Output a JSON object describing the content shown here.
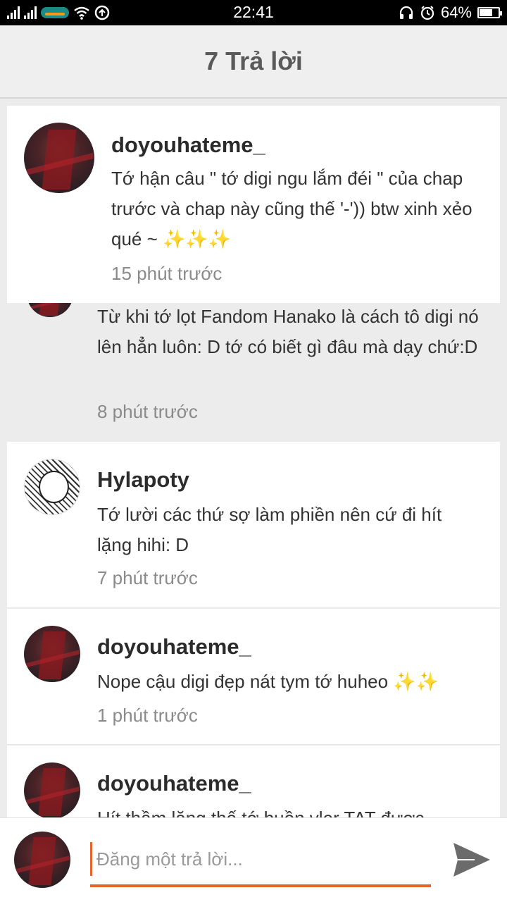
{
  "status_bar": {
    "time": "22:41",
    "battery_percent": "64%",
    "battery_level": 0.64,
    "icons": [
      "signal-icon",
      "signal-icon",
      "carrier-logo",
      "wifi-icon",
      "sync-icon",
      "headset-icon",
      "alarm-icon",
      "battery-icon"
    ]
  },
  "header": {
    "title": "7 Trả lời"
  },
  "comments": [
    {
      "username": "doyouhateme_",
      "text": "Tớ hận câu \" tớ digi ngu lắm đéi \" của chap trước và chap này cũng thế '-')) btw xinh xẻo qué ~ ✨✨✨",
      "time": "15 phút trước"
    },
    {
      "username": "",
      "text": "Từ khi tớ lọt Fandom Hanako là cách tô digi nó lên hẳn luôn: D tớ có biết gì đâu mà dạy chứ:D",
      "time": "8 phút trước"
    },
    {
      "username": "Hylapoty",
      "text": "Tớ lười các thứ sợ làm phiền nên cứ đi hít lặng hihi: D",
      "time": "7 phút trước"
    },
    {
      "username": "doyouhateme_",
      "text": "Nope cậu digi đẹp nát tym tớ huheo ✨✨",
      "time": "1 phút trước"
    },
    {
      "username": "doyouhateme_",
      "text": "Hít thầm lặng thế tớ buồn vler TAT được",
      "time": ""
    }
  ],
  "composer": {
    "placeholder": "Đăng một trả lời..."
  },
  "colors": {
    "accent": "#e9642b",
    "background": "#ececec",
    "card": "#ffffff",
    "header_text": "#5a5a5a"
  }
}
